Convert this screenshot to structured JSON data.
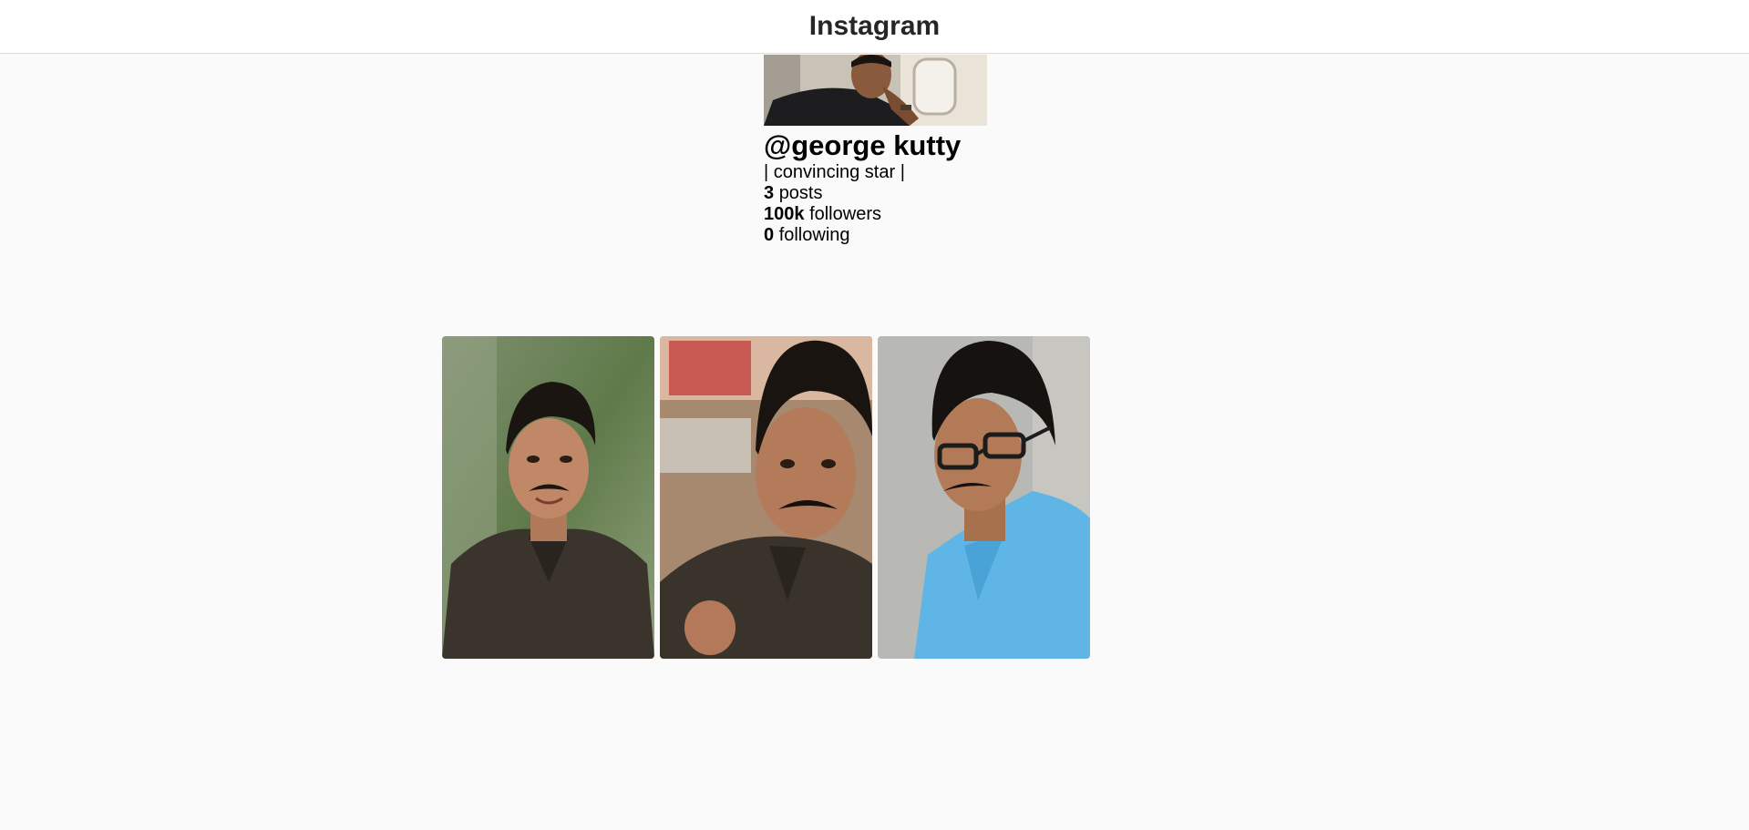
{
  "header": {
    "brand": "Instagram"
  },
  "profile": {
    "avatar_alt": "profile-photo",
    "username": "@george kutty",
    "bio": "| convincing star |",
    "stats": [
      {
        "value": "3",
        "label": "posts"
      },
      {
        "value": "100k",
        "label": "followers"
      },
      {
        "value": "0",
        "label": "following"
      }
    ]
  },
  "posts": [
    {
      "name": "post-1"
    },
    {
      "name": "post-2"
    },
    {
      "name": "post-3"
    }
  ],
  "colors": {
    "background": "#fafafa",
    "header_bg": "#ffffff",
    "border": "#dbdbdb",
    "text": "#000000"
  }
}
